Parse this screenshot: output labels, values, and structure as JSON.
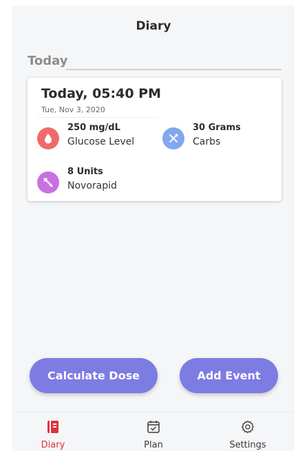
{
  "header": {
    "title": "Diary"
  },
  "section": {
    "title": "Today"
  },
  "card": {
    "time": "Today, 05:40 PM",
    "date": "Tue, Nov 3, 2020",
    "entries": [
      {
        "value": "250 mg/dL",
        "label": "Glucose Level",
        "icon": "blood-drop-icon",
        "color": "#ef6b6b"
      },
      {
        "value": "30 Grams",
        "label": "Carbs",
        "icon": "fork-knife-icon",
        "color": "#82a6f0"
      },
      {
        "value": "8 Units",
        "label": "Novorapid",
        "icon": "syringe-icon",
        "color": "#c970e3"
      }
    ]
  },
  "actions": {
    "calculate_label": "Calculate Dose",
    "add_label": "Add Event",
    "color": "#7c7ce3"
  },
  "nav": {
    "items": [
      {
        "label": "Diary",
        "icon": "diary-book-icon",
        "active": true
      },
      {
        "label": "Plan",
        "icon": "calendar-check-icon",
        "active": false
      },
      {
        "label": "Settings",
        "icon": "gear-icon",
        "active": false
      }
    ],
    "active_color": "#e0313c"
  }
}
